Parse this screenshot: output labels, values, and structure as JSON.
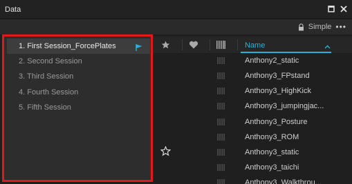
{
  "window": {
    "title": "Data"
  },
  "toolbar": {
    "view_label": "Simple",
    "more_label": "•••"
  },
  "sessions": [
    {
      "label": "1. First Session_ForcePlates",
      "active": true
    },
    {
      "label": "2. Second Session",
      "active": false
    },
    {
      "label": "3. Third Session",
      "active": false
    },
    {
      "label": "4. Fourth Session",
      "active": false
    },
    {
      "label": "5. Fifth Session",
      "active": false
    }
  ],
  "table": {
    "name_header": "Name",
    "rows": [
      {
        "name": "Anthony2_static",
        "starred": false
      },
      {
        "name": "Anthony3_FPstand",
        "starred": false
      },
      {
        "name": "Anthony3_HighKick",
        "starred": false
      },
      {
        "name": "Anthony3_jumpingjac...",
        "starred": false
      },
      {
        "name": "Anthony3_Posture",
        "starred": false
      },
      {
        "name": "Anthony3_ROM",
        "starred": false
      },
      {
        "name": "Anthony3_static",
        "starred": true
      },
      {
        "name": "Anthony3_taichi",
        "starred": false
      },
      {
        "name": "Anthony3_Walkthrou...",
        "starred": false
      }
    ]
  },
  "colors": {
    "accent": "#25b3d9",
    "highlight_border": "#e11919"
  }
}
